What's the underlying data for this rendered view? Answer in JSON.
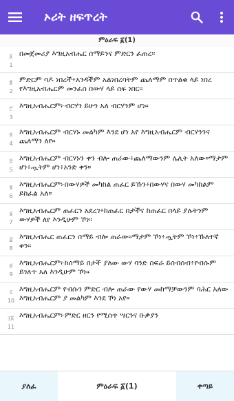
{
  "appbar": {
    "title": "ኦሪት ዘፍጥረት",
    "menu_icon": "hamburger-menu-icon",
    "search_icon": "search-icon",
    "more_icon": "more-vertical-icon",
    "color": "#6a4bd6"
  },
  "chapter_header": "ምዕራፍ ፩(1)",
  "verses": [
    {
      "num": "፩\n1",
      "text": "በመጀመሪያ እግዚአብሔር ሰማይንና ምድርን ፈጠረ።"
    },
    {
      "num": "፪\n2",
      "text": "ምድርም ባዶ ነበረች፥አንዳችም አልነበረባትም ጨለማም በጥልቁ ላይ ነበረ የእግዚአብሔርም መንፈስ በውሃ ላይ ሰፍ ነበር።"
    },
    {
      "num": "፫\n3",
      "text": "እግዚአብሔርም፦ብርሃን ይሁን አለ ብርሃንም ሆነ።"
    },
    {
      "num": "፬\n4",
      "text": "እግዚአብሔርም ብርሃኑ መልካም እንደ ሆነ አየ እግዚአብሔርም ብርሃንንና ጨለማን ለየ።"
    },
    {
      "num": "፭\n5",
      "text": "እግዚአብሔርም ብርሃኑን ቀን ብሎ ጠራው፥ጨለማውንም ሌሊት አለው።ማታም ሆነ፥ጧትም ሆነ፥አንድ ቀን።"
    },
    {
      "num": "፮\n6",
      "text": "እግዚአብሔርም፦በውሃዎች መካከል ጠፈር ይኹን፥በውሃና በውሃ መካከልም ይከፈል አለ።"
    },
    {
      "num": "፯\n7",
      "text": "እግዚአብሔርም ጠፈርን አደረገ፥ከጠፈር በታችና ከጠፈር በላይ ያሉትንም ውሃዎች ለየ እንዲሁም ኾነ።"
    },
    {
      "num": "፰\n8",
      "text": "እግዚአብሔር ጠፈርን ሰማይ ብሎ ጠራው።ማታም ኾነ፥ጧትም ኾነ፥ኹለተኛ ቀን።"
    },
    {
      "num": "፱\n9",
      "text": "እግዚአብሔርም፦ከሰማይ በታች ያለው ውሃ ባንድ ስፍራ ይሰብሰብ፥የብሱም ይገለጥ አለ እንዲሁም ኾነ።"
    },
    {
      "num": "፲\n10",
      "text": "እግዚአብሔርም የብሱን ምድር ብሎ ጠራው የውሃ መከማቻውንም ባሕር አለው እግዚአብሔርም ያ መልካም እንደ ኾነ አየ።"
    },
    {
      "num": "፲፩\n11",
      "text": "እግዚአብሔርም፦ምድር ዘርን የሚሰጥ ሣርንና ቡቃያን"
    }
  ],
  "bottom_nav": {
    "prev_label": "ያለፈ",
    "current_label": "ምዕራፍ ፩(1)",
    "next_label": "ቀጣይ"
  }
}
